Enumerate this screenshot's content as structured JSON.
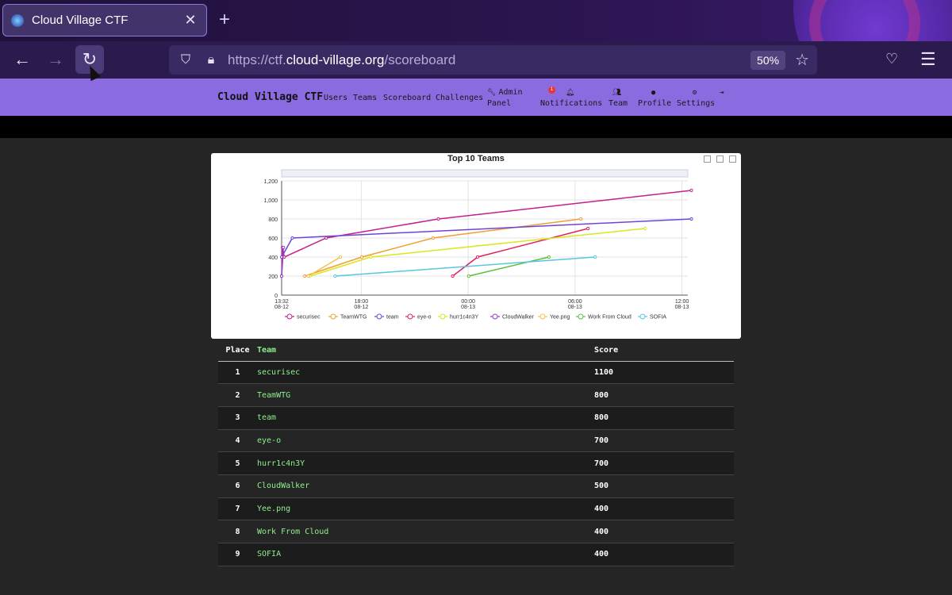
{
  "browser": {
    "tab_title": "Cloud Village CTF",
    "url_scheme": "https://ctf.",
    "url_host": "cloud-village.org",
    "url_path": "/scoreboard",
    "zoom": "50%"
  },
  "site": {
    "brand": "Cloud Village CTF",
    "nav": [
      {
        "label": "Users"
      },
      {
        "label": "Teams"
      },
      {
        "label": "Scoreboard"
      },
      {
        "label": "Challenges"
      },
      {
        "label": "Admin Panel",
        "icon": "wrench-icon"
      },
      {
        "label": "Notifications",
        "icon": "bell-icon",
        "badge": "1"
      },
      {
        "label": "Team",
        "icon": "users-icon"
      },
      {
        "label": "Profile",
        "icon": "user-circle-icon"
      },
      {
        "label": "Settings",
        "icon": "cogs-icon"
      },
      {
        "label": "",
        "icon": "logout-icon"
      }
    ]
  },
  "chart_data": {
    "type": "line",
    "title": "Top 10 Teams",
    "x_ticks": [
      {
        "time": "13:32",
        "date": "08-12"
      },
      {
        "time": "18:00",
        "date": "08-12"
      },
      {
        "time": "00:00",
        "date": "08-13"
      },
      {
        "time": "06:00",
        "date": "08-13"
      },
      {
        "time": "12:00",
        "date": "08-13"
      }
    ],
    "y_ticks": [
      "0",
      "200",
      "400",
      "600",
      "800",
      "1,000",
      "1,200"
    ],
    "ylim": [
      0,
      1200
    ],
    "xlim_hours": [
      0,
      22.8
    ],
    "series": [
      {
        "name": "securisec",
        "color": "#c2218e",
        "points": [
          [
            0,
            200
          ],
          [
            0.05,
            500
          ],
          [
            0.15,
            400
          ],
          [
            2.5,
            600
          ],
          [
            8.8,
            800
          ],
          [
            23,
            1100
          ]
        ]
      },
      {
        "name": "TeamWTG",
        "color": "#f0a030",
        "points": [
          [
            1.3,
            200
          ],
          [
            4.5,
            400
          ],
          [
            8.5,
            600
          ],
          [
            16.8,
            800
          ]
        ]
      },
      {
        "name": "team",
        "color": "#6e44d8",
        "points": [
          [
            0,
            400
          ],
          [
            0.6,
            600
          ],
          [
            23,
            800
          ]
        ]
      },
      {
        "name": "eye-o",
        "color": "#e0225c",
        "points": [
          [
            9.6,
            200
          ],
          [
            11,
            400
          ],
          [
            17.2,
            700
          ]
        ]
      },
      {
        "name": "hurr1c4n3Y",
        "color": "#d8e81c",
        "points": [
          [
            1.6,
            200
          ],
          [
            5,
            400
          ],
          [
            20.4,
            700
          ]
        ]
      },
      {
        "name": "CloudWalker",
        "color": "#9a3cc8",
        "points": [
          [
            0,
            200
          ],
          [
            0.1,
            500
          ]
        ]
      },
      {
        "name": "Yee.png",
        "color": "#f5c04a",
        "points": [
          [
            1.5,
            200
          ],
          [
            3.3,
            400
          ]
        ]
      },
      {
        "name": "Work From Cloud",
        "color": "#5bbf3a",
        "points": [
          [
            10.5,
            200
          ],
          [
            15,
            400
          ]
        ]
      },
      {
        "name": "SOFIA",
        "color": "#58c6e0",
        "points": [
          [
            3,
            200
          ],
          [
            17.6,
            400
          ]
        ]
      }
    ]
  },
  "table": {
    "headers": {
      "place": "Place",
      "team": "Team",
      "score": "Score"
    },
    "rows": [
      {
        "place": "1",
        "team": "securisec",
        "score": "1100"
      },
      {
        "place": "2",
        "team": "TeamWTG",
        "score": "800"
      },
      {
        "place": "3",
        "team": "team",
        "score": "800"
      },
      {
        "place": "4",
        "team": "eye-o",
        "score": "700"
      },
      {
        "place": "5",
        "team": "hurr1c4n3Y",
        "score": "700"
      },
      {
        "place": "6",
        "team": "CloudWalker",
        "score": "500"
      },
      {
        "place": "7",
        "team": "Yee.png",
        "score": "400"
      },
      {
        "place": "8",
        "team": "Work From Cloud",
        "score": "400"
      },
      {
        "place": "9",
        "team": "SOFIA",
        "score": "400"
      }
    ]
  }
}
